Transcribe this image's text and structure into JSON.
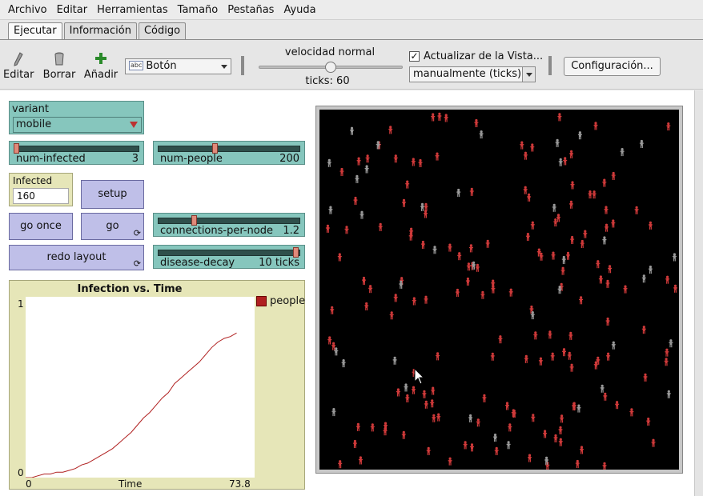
{
  "menu": [
    "Archivo",
    "Editar",
    "Herramientas",
    "Tamaño",
    "Pestañas",
    "Ayuda"
  ],
  "tabs": [
    {
      "label": "Ejecutar",
      "active": true
    },
    {
      "label": "Información",
      "active": false
    },
    {
      "label": "Código",
      "active": false
    }
  ],
  "toolbar": {
    "edit_label": "Editar",
    "delete_label": "Borrar",
    "add_label": "Añadir",
    "widget_type": "Botón",
    "widget_icon_text": "abc",
    "speed_label": "velocidad normal",
    "speed_fraction": 0.5,
    "ticks_text": "ticks: 60",
    "update_view_label": "Actualizar de la Vista...",
    "update_view_checked": true,
    "update_mode": "manualmente (ticks)",
    "settings_label": "Configuración...",
    "accent_green": "#2a8a2a"
  },
  "widgets": {
    "variant": {
      "label": "variant",
      "value": "mobile"
    },
    "num_infected": {
      "label": "num-infected",
      "value": "3",
      "fraction": 0.0
    },
    "num_people": {
      "label": "num-people",
      "value": "200",
      "fraction": 0.4
    },
    "infected_monitor": {
      "label": "Infected",
      "value": "160"
    },
    "setup": {
      "label": "setup"
    },
    "go_once": {
      "label": "go once"
    },
    "go": {
      "label": "go",
      "forever": true
    },
    "connections_per_node": {
      "label": "connections-per-node",
      "value": "1.2",
      "fraction": 0.25
    },
    "redo_layout": {
      "label": "redo layout",
      "forever": true
    },
    "disease_decay": {
      "label": "disease-decay",
      "value": "10 ticks",
      "fraction": 1.0
    }
  },
  "chart_data": {
    "type": "line",
    "title": "Infection vs. Time",
    "xlabel": "Time",
    "x_min_label": "0",
    "x_max_label": "73.8",
    "y_min_label": "0",
    "y_max_label": "1",
    "xlim": [
      0,
      73.8
    ],
    "ylim": [
      0,
      1
    ],
    "series": [
      {
        "name": "people",
        "color": "#b02020",
        "x": [
          0,
          2,
          4,
          6,
          8,
          10,
          12,
          14,
          16,
          18,
          20,
          22,
          24,
          26,
          28,
          30,
          32,
          34,
          36,
          38,
          40,
          42,
          44,
          46,
          48,
          50,
          52,
          54,
          56,
          58,
          60,
          62,
          64,
          66,
          68
        ],
        "y": [
          0.0,
          0.0,
          0.01,
          0.02,
          0.02,
          0.03,
          0.03,
          0.04,
          0.05,
          0.07,
          0.08,
          0.1,
          0.12,
          0.14,
          0.16,
          0.19,
          0.22,
          0.25,
          0.29,
          0.33,
          0.36,
          0.4,
          0.44,
          0.47,
          0.52,
          0.55,
          0.58,
          0.61,
          0.64,
          0.68,
          0.72,
          0.75,
          0.77,
          0.78,
          0.8
        ]
      }
    ]
  },
  "view": {
    "background": "#000000",
    "infected_color": "#d03a3a",
    "healthy_color": "#9a9a9a",
    "agents_infected": 160,
    "agents_total": 200
  }
}
